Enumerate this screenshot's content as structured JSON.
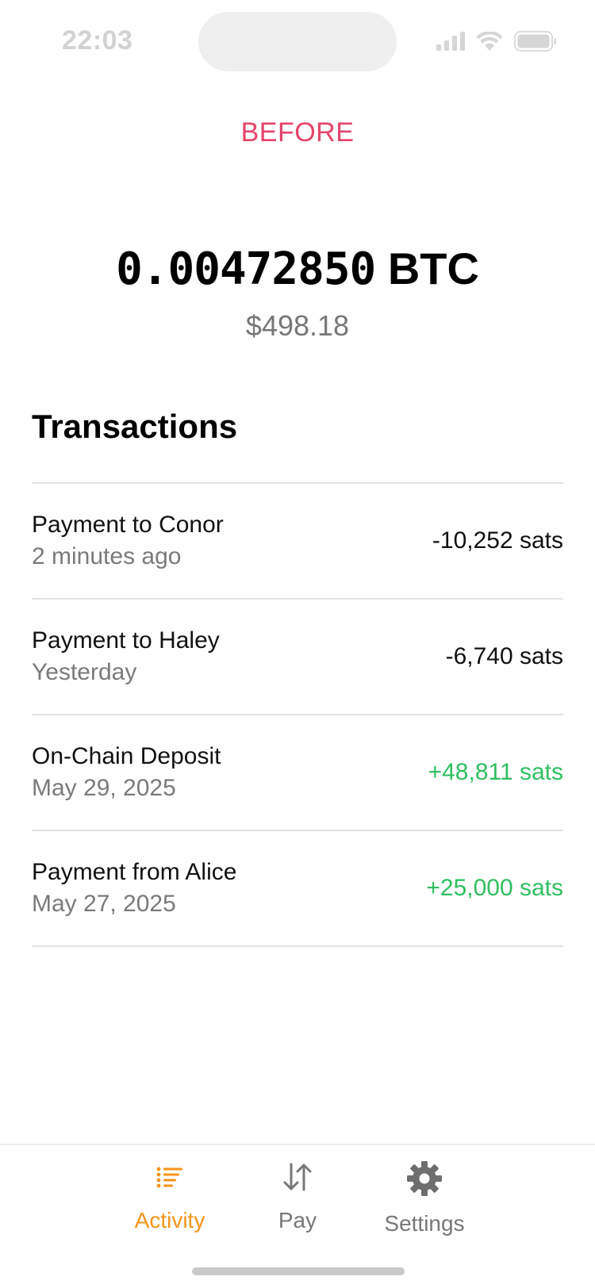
{
  "status_bar": {
    "time": "22:03",
    "icons": [
      "cellular-signal-icon",
      "wifi-icon",
      "battery-icon"
    ]
  },
  "header": {
    "mode_label": "BEFORE"
  },
  "balance": {
    "amount": "0.00472850",
    "unit": "BTC",
    "fiat": "$498.18"
  },
  "transactions": {
    "heading": "Transactions",
    "items": [
      {
        "title": "Payment to Conor",
        "subtitle": "2 minutes ago",
        "amount": "-10,252 sats",
        "direction": "outgoing"
      },
      {
        "title": "Payment to Haley",
        "subtitle": "Yesterday",
        "amount": "-6,740 sats",
        "direction": "outgoing"
      },
      {
        "title": "On-Chain Deposit",
        "subtitle": "May 29, 2025",
        "amount": "+48,811 sats",
        "direction": "incoming"
      },
      {
        "title": "Payment from Alice",
        "subtitle": "May 27, 2025",
        "amount": "+25,000 sats",
        "direction": "incoming"
      }
    ]
  },
  "tab_bar": {
    "tabs": [
      {
        "label": "Activity",
        "icon": "activity-list-icon",
        "active": true
      },
      {
        "label": "Pay",
        "icon": "arrows-up-down-icon",
        "active": false
      },
      {
        "label": "Settings",
        "icon": "gear-icon",
        "active": false
      }
    ]
  },
  "colors": {
    "accent": "#f7931a",
    "mode_label": "#e4446a",
    "positive": "#2fbf5f",
    "muted": "#7a7a7a",
    "divider": "#e2e2e2"
  }
}
